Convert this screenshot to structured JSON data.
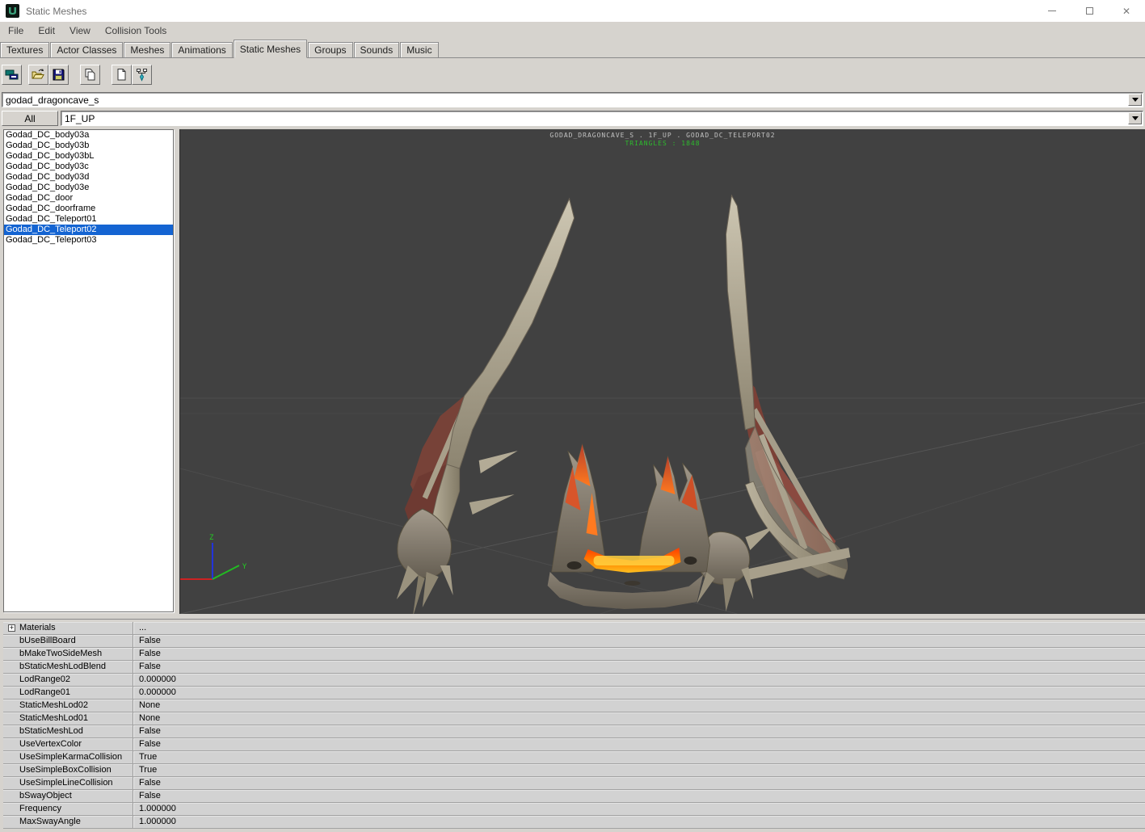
{
  "window": {
    "title": "Static Meshes",
    "controls": {
      "minimize": "minimize",
      "maximize": "maximize",
      "close": "✕"
    }
  },
  "menu": {
    "items": [
      "File",
      "Edit",
      "View",
      "Collision Tools"
    ]
  },
  "tabs": {
    "items": [
      "Textures",
      "Actor Classes",
      "Meshes",
      "Animations",
      "Static Meshes",
      "Groups",
      "Sounds",
      "Music"
    ],
    "active": "Static Meshes"
  },
  "toolbar": {
    "buttons": [
      "dock-toggle-icon",
      "open-package-icon",
      "save-package-icon",
      "copy-icon",
      "new-document-icon",
      "collision-tool-icon"
    ]
  },
  "package_combo": {
    "value": "godad_dragoncave_s"
  },
  "filter_row": {
    "all_button_label": "All",
    "group_combo_value": "1F_UP"
  },
  "mesh_list": {
    "items": [
      "Godad_DC_body03a",
      "Godad_DC_body03b",
      "Godad_DC_body03bL",
      "Godad_DC_body03c",
      "Godad_DC_body03d",
      "Godad_DC_body03e",
      "Godad_DC_door",
      "Godad_DC_doorframe",
      "Godad_DC_Teleport01",
      "Godad_DC_Teleport02",
      "Godad_DC_Teleport03"
    ],
    "selected_index": 9
  },
  "viewport": {
    "header_line1": "GODAD_DRAGONCAVE_S . 1F_UP . GODAD_DC_TELEPORT02",
    "header_line2": "TRIANGLES : 1848",
    "axis_z": "Z",
    "axis_y": "Y"
  },
  "properties": {
    "rows": [
      {
        "label": "Materials",
        "value": "...",
        "expandable": true
      },
      {
        "label": "bUseBillBoard",
        "value": "False"
      },
      {
        "label": "bMakeTwoSideMesh",
        "value": "False"
      },
      {
        "label": "bStaticMeshLodBlend",
        "value": "False"
      },
      {
        "label": "LodRange02",
        "value": "0.000000"
      },
      {
        "label": "LodRange01",
        "value": "0.000000"
      },
      {
        "label": "StaticMeshLod02",
        "value": "None"
      },
      {
        "label": "StaticMeshLod01",
        "value": "None"
      },
      {
        "label": "bStaticMeshLod",
        "value": "False"
      },
      {
        "label": "UseVertexColor",
        "value": "False"
      },
      {
        "label": "UseSimpleKarmaCollision",
        "value": "True"
      },
      {
        "label": "UseSimpleBoxCollision",
        "value": "True"
      },
      {
        "label": "UseSimpleLineCollision",
        "value": "False"
      },
      {
        "label": "bSwayObject",
        "value": "False"
      },
      {
        "label": "Frequency",
        "value": "1.000000"
      },
      {
        "label": "MaxSwayAngle",
        "value": "1.000000"
      }
    ]
  },
  "colors": {
    "selection": "#1464d2",
    "viewport_background": "#414141",
    "triangles_text": "#2dbb2d",
    "axis_x": "#cc2222",
    "axis_y": "#22bb22",
    "axis_z": "#2233dd",
    "lava_accent": "#ff8800"
  }
}
